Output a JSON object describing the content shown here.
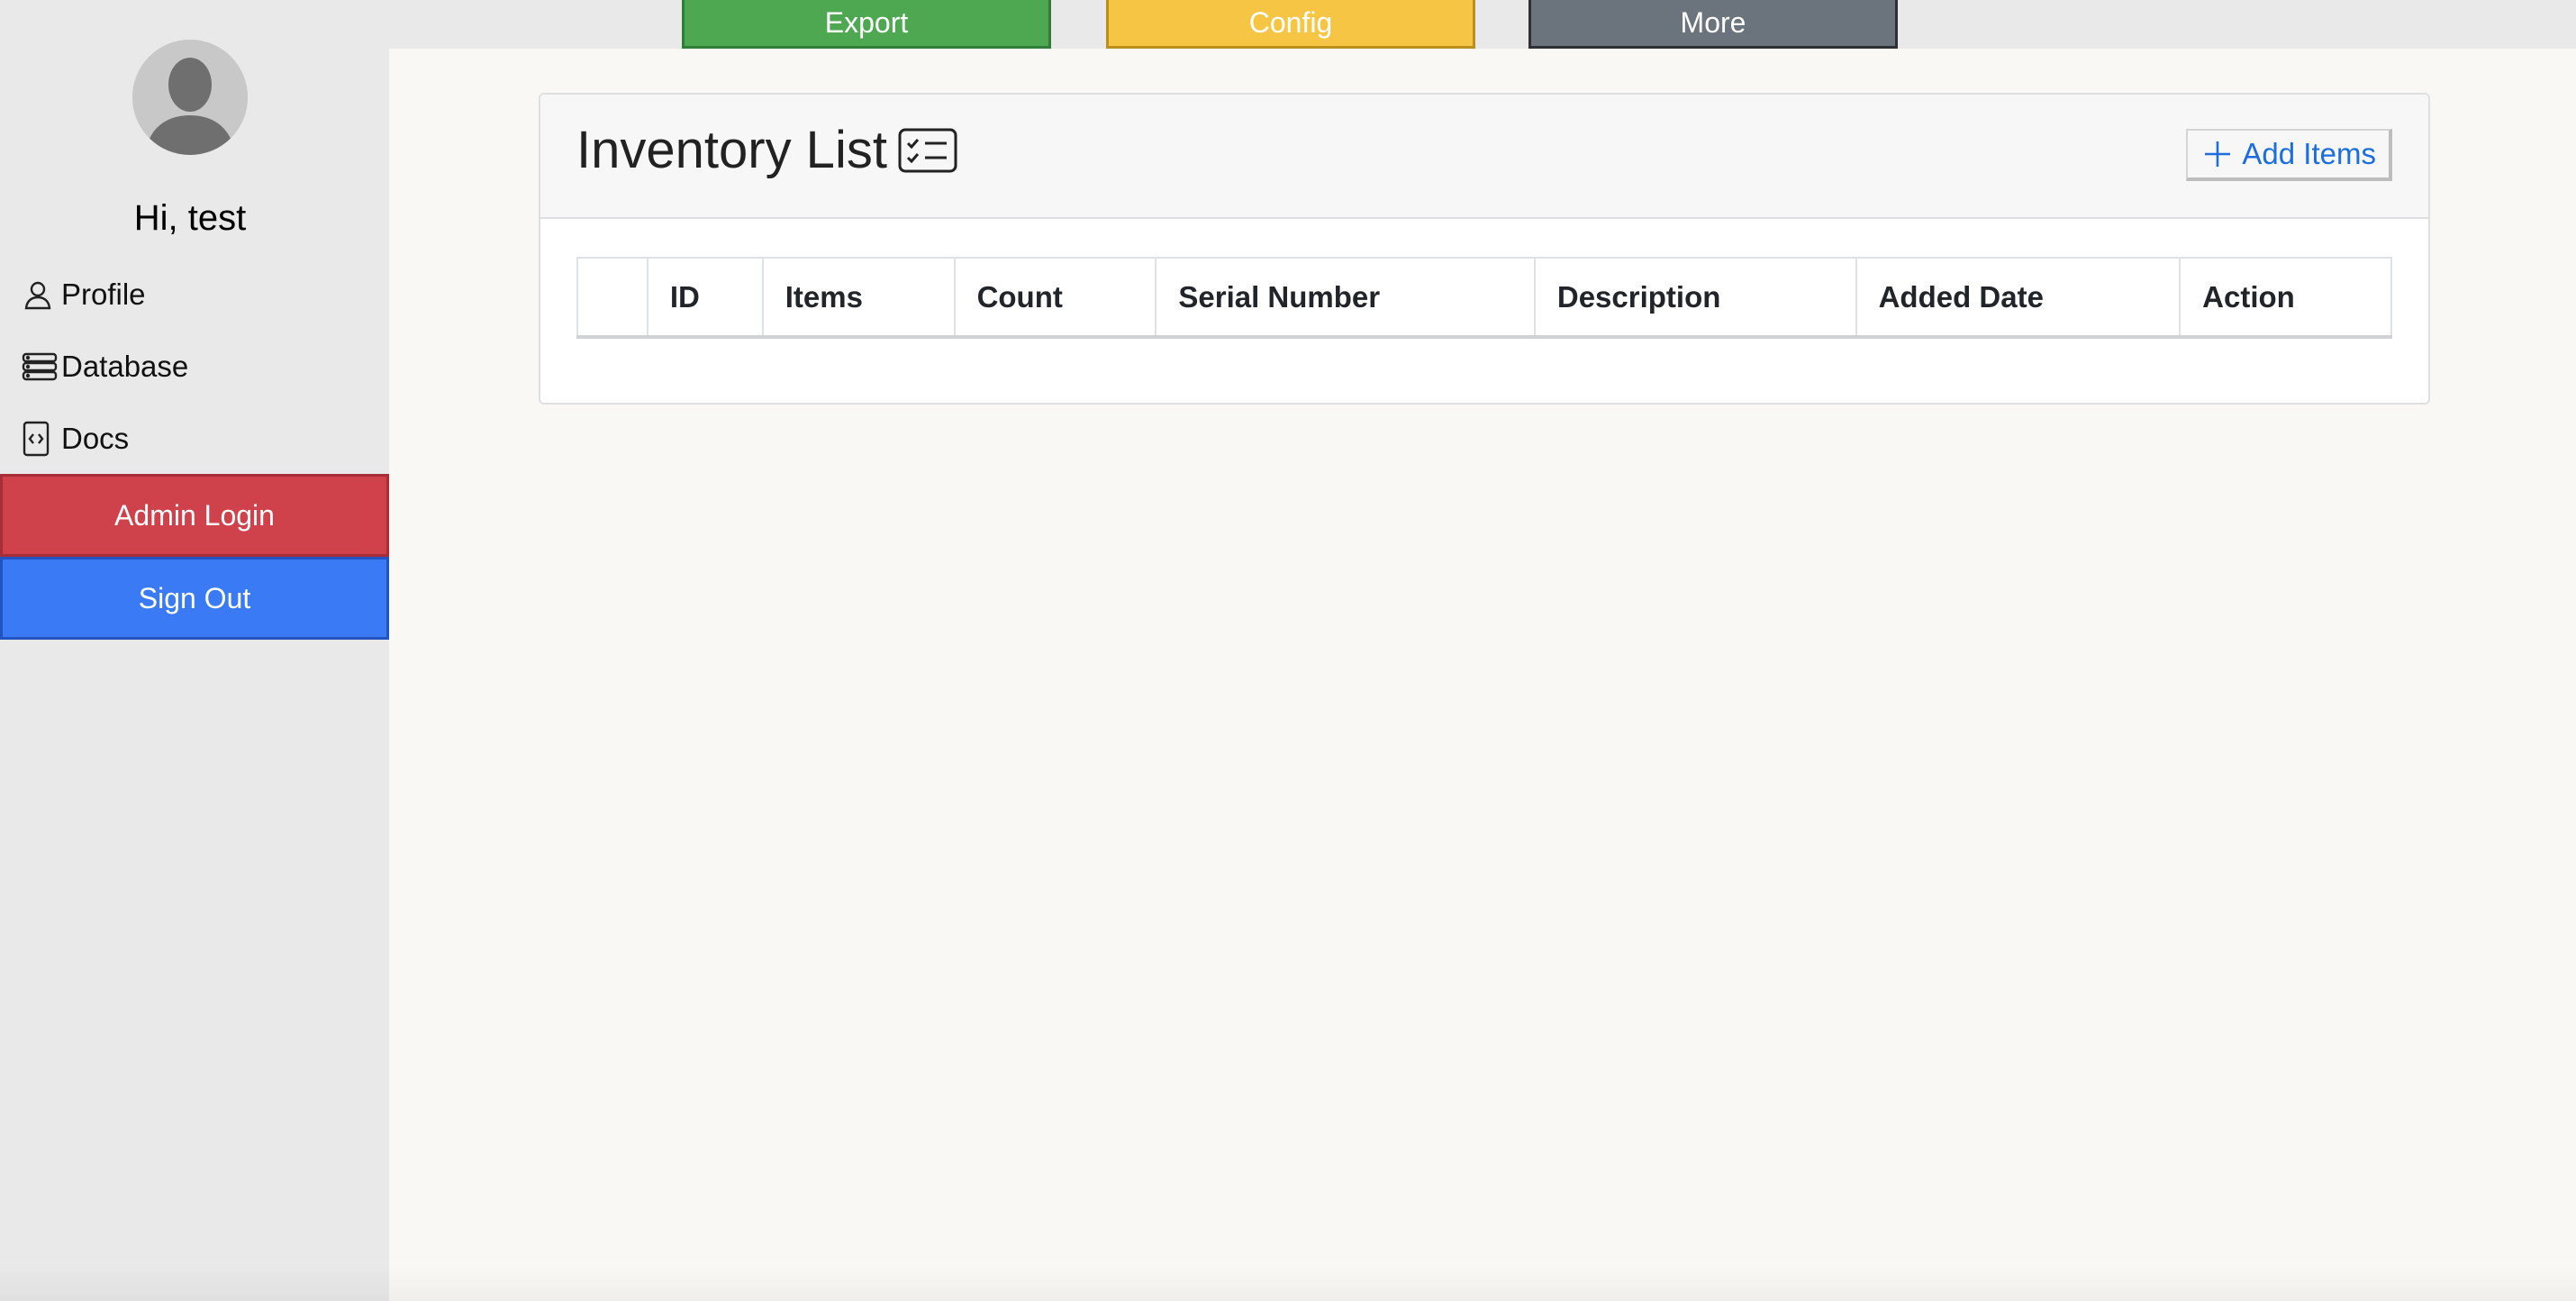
{
  "topbar": {
    "export_label": "Export",
    "config_label": "Config",
    "more_label": "More"
  },
  "sidebar": {
    "greeting": "Hi, test",
    "items": [
      {
        "label": "Profile",
        "icon": "person-icon"
      },
      {
        "label": "Database",
        "icon": "database-icon"
      },
      {
        "label": "Docs",
        "icon": "code-file-icon"
      }
    ],
    "admin_label": "Admin Login",
    "signout_label": "Sign Out"
  },
  "card": {
    "title": "Inventory List",
    "title_icon": "checklist-icon",
    "add_label": "Add Items",
    "add_icon": "plus-icon"
  },
  "table": {
    "columns": [
      "",
      "ID",
      "Items",
      "Count",
      "Serial Number",
      "Description",
      "Added Date",
      "Action"
    ],
    "rows": []
  },
  "colors": {
    "export": "#4ea852",
    "config": "#f7c544",
    "more": "#6b737c",
    "admin": "#d0424b",
    "signout": "#3a7af5",
    "link": "#1b6ee0"
  }
}
